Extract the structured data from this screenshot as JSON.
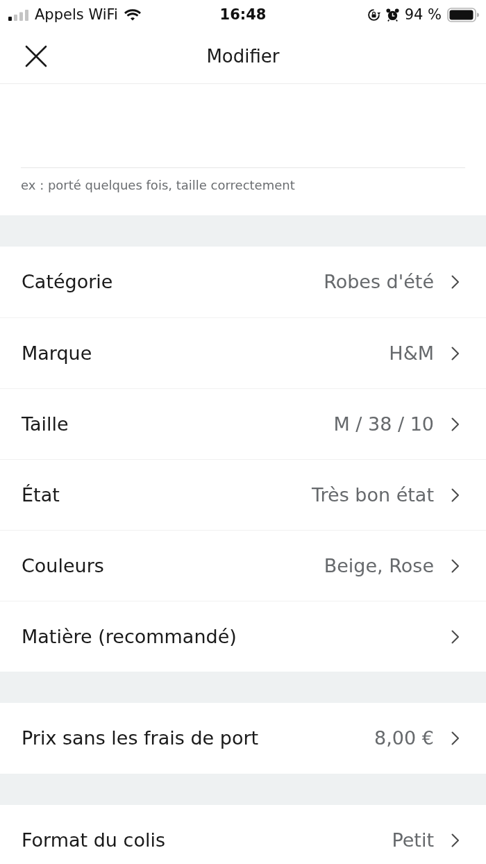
{
  "status_bar": {
    "carrier": "Appels WiFi",
    "time": "16:48",
    "battery": "94 %"
  },
  "nav_bar": {
    "title": "Modifier"
  },
  "description": {
    "hint": "ex : porté quelques fois, taille correctement"
  },
  "sections": [
    {
      "rows": [
        {
          "label": "Catégorie",
          "value": "Robes d'été"
        },
        {
          "label": "Marque",
          "value": "H&M"
        },
        {
          "label": "Taille",
          "value": "M / 38 / 10"
        },
        {
          "label": "État",
          "value": "Très bon état"
        },
        {
          "label": "Couleurs",
          "value": "Beige, Rose"
        },
        {
          "label": "Matière (recommandé)"
        }
      ]
    },
    {
      "rows": [
        {
          "label": "Prix sans les frais de port",
          "value": "8,00 €"
        }
      ]
    },
    {
      "rows": [
        {
          "label": "Format du colis",
          "value": "Petit"
        }
      ]
    }
  ]
}
